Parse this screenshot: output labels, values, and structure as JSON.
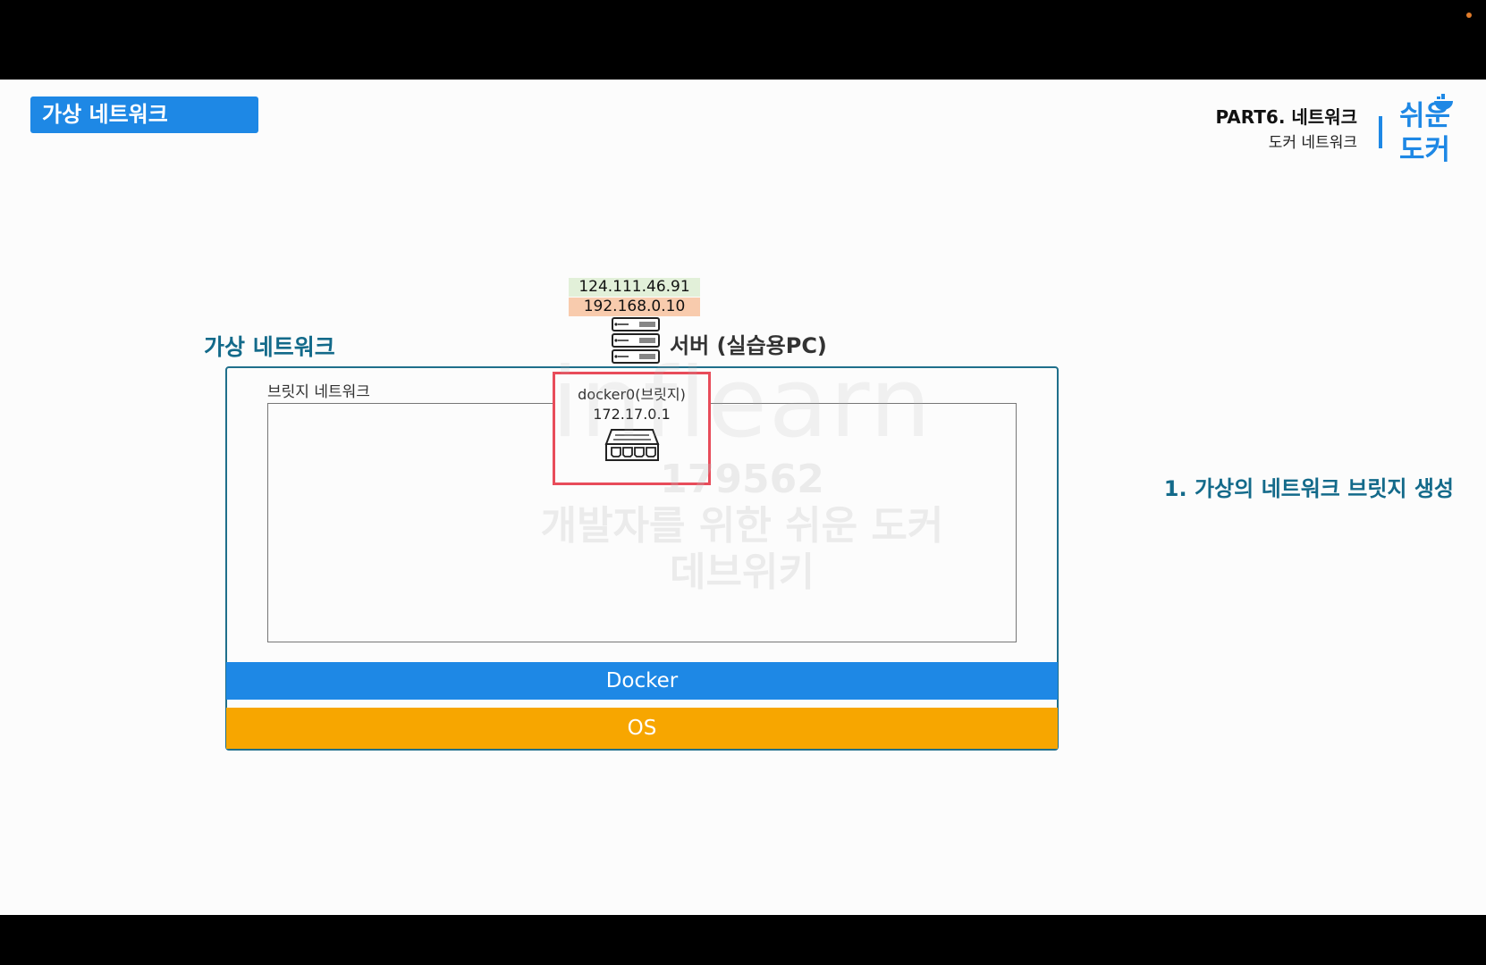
{
  "header": {
    "section_title": "가상 네트워크",
    "part": "PART6. 네트워크",
    "subtitle": "도커 네트워크",
    "logo_line1": "쉬운",
    "logo_line2": "도커"
  },
  "diagram": {
    "network_heading": "가상 네트워크",
    "ip_public": "124.111.46.91",
    "ip_private": "192.168.0.10",
    "server_label": "서버 (실습용PC)",
    "bridge_network_label": "브릿지 네트워크",
    "docker0_name": "docker0(브릿지)",
    "docker0_ip": "172.17.0.1",
    "docker_layer": "Docker",
    "os_layer": "OS"
  },
  "step": "1. 가상의 네트워크 브릿지 생성",
  "watermark": {
    "logo": "inflearn",
    "line1": "179562",
    "line2": "개발자를 위한 쉬운 도커",
    "line3": "데브위키"
  },
  "colors": {
    "accent_blue": "#1e88e5",
    "teal": "#136a8a",
    "os_orange": "#f7a600",
    "highlight_red": "#e84c5a"
  }
}
